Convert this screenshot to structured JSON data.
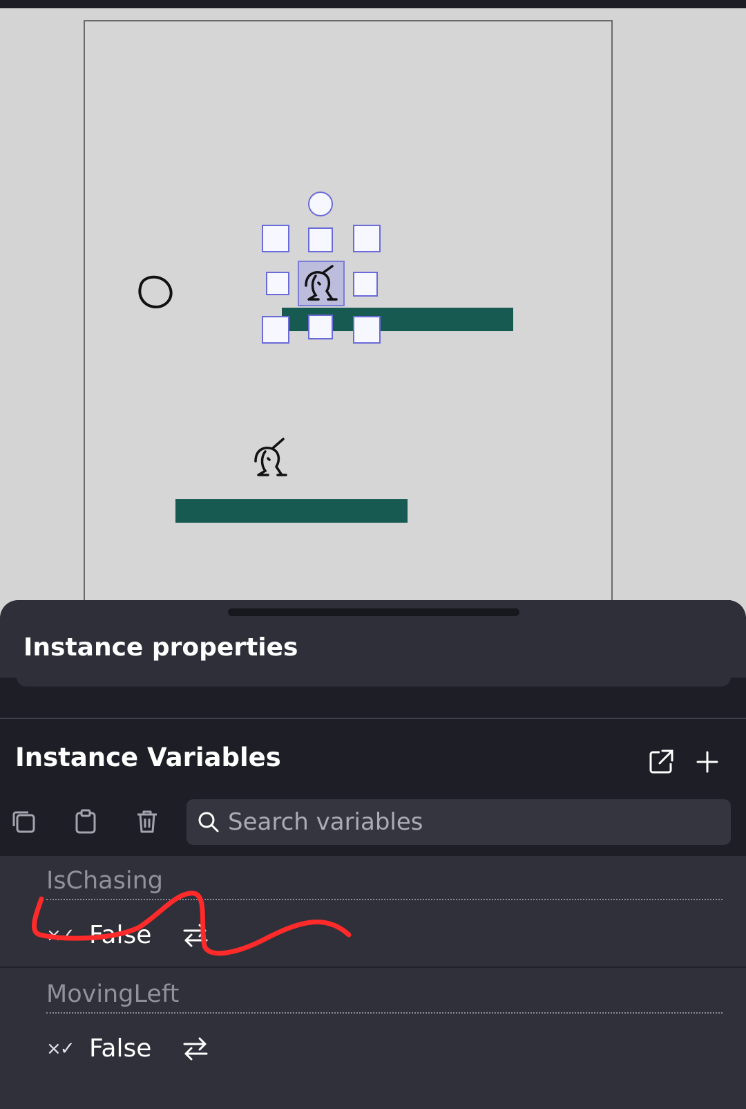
{
  "sheet": {
    "title": "Instance properties"
  },
  "instance_variables": {
    "title": "Instance Variables",
    "header_icons": [
      "open-external-icon",
      "plus-icon"
    ],
    "toolbar_icons": [
      "copy-icon",
      "clipboard-icon",
      "trash-icon"
    ],
    "search_placeholder": "Search variables"
  },
  "variables": [
    {
      "name": "IsChasing",
      "type_icon": "×✓",
      "value": "False"
    },
    {
      "name": "MovingLeft",
      "type_icon": "×✓",
      "value": "False"
    }
  ],
  "colors": {
    "platform": "#165a52",
    "selection": "#7b7bd9",
    "annotation": "#ff2a2a",
    "sheet_bg": "#2e2f38",
    "dark_bg": "#1e1f26"
  }
}
